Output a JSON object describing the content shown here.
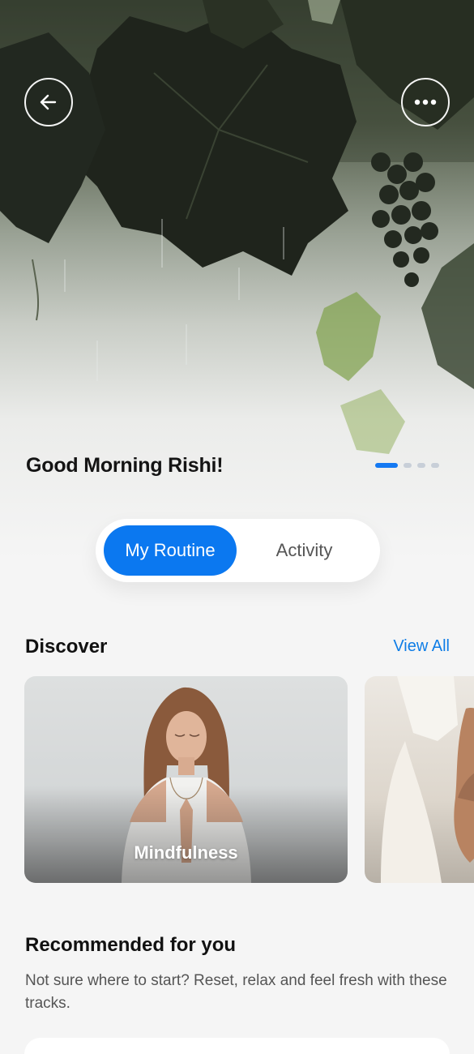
{
  "hero": {
    "greeting": "Good Morning Rishi!",
    "back_icon": "arrow-left-icon",
    "more_icon": "more-horizontal-icon",
    "carousel": {
      "count": 4,
      "active_index": 0
    }
  },
  "tabs": [
    {
      "label": "My Routine",
      "active": true
    },
    {
      "label": "Activity",
      "active": false
    }
  ],
  "discover": {
    "title": "Discover",
    "view_all": "View All",
    "cards": [
      {
        "label": "Mindfulness"
      }
    ]
  },
  "recommended": {
    "title": "Recommended for you",
    "subtitle": "Not sure where to start? Reset, relax and feel fresh with these tracks."
  },
  "colors": {
    "accent": "#0b78f0",
    "link": "#0f7de6",
    "background": "#f5f5f5"
  }
}
